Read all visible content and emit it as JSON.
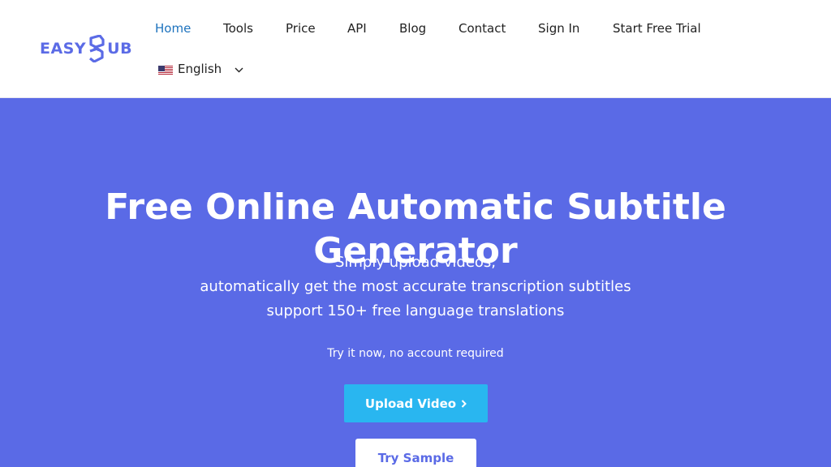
{
  "brand": {
    "logo_left": "EASY",
    "logo_right": "UB",
    "logo_color": "#5b6be6"
  },
  "nav": {
    "items": [
      {
        "label": "Home",
        "active": true
      },
      {
        "label": "Tools",
        "active": false
      },
      {
        "label": "Price",
        "active": false
      },
      {
        "label": "API",
        "active": false
      },
      {
        "label": "Blog",
        "active": false
      },
      {
        "label": "Contact",
        "active": false
      },
      {
        "label": "Sign In",
        "active": false
      },
      {
        "label": "Start Free Trial",
        "active": false
      }
    ],
    "language": {
      "label": "English",
      "flag_icon": "us-flag-icon",
      "chevron_icon": "chevron-down-icon"
    }
  },
  "hero": {
    "title": "Free Online Automatic Subtitle Generator",
    "subtitle_lines": [
      "Simply upload videos,",
      "automatically get the most accurate transcription subtitles",
      "support 150+ free language translations"
    ],
    "note": "Try it now, no account required",
    "upload_button": "Upload Video",
    "upload_icon": "chevron-right-icon",
    "sample_button": "Try Sample",
    "background_color": "#5a6ae6",
    "upload_color": "#29b6f0"
  }
}
